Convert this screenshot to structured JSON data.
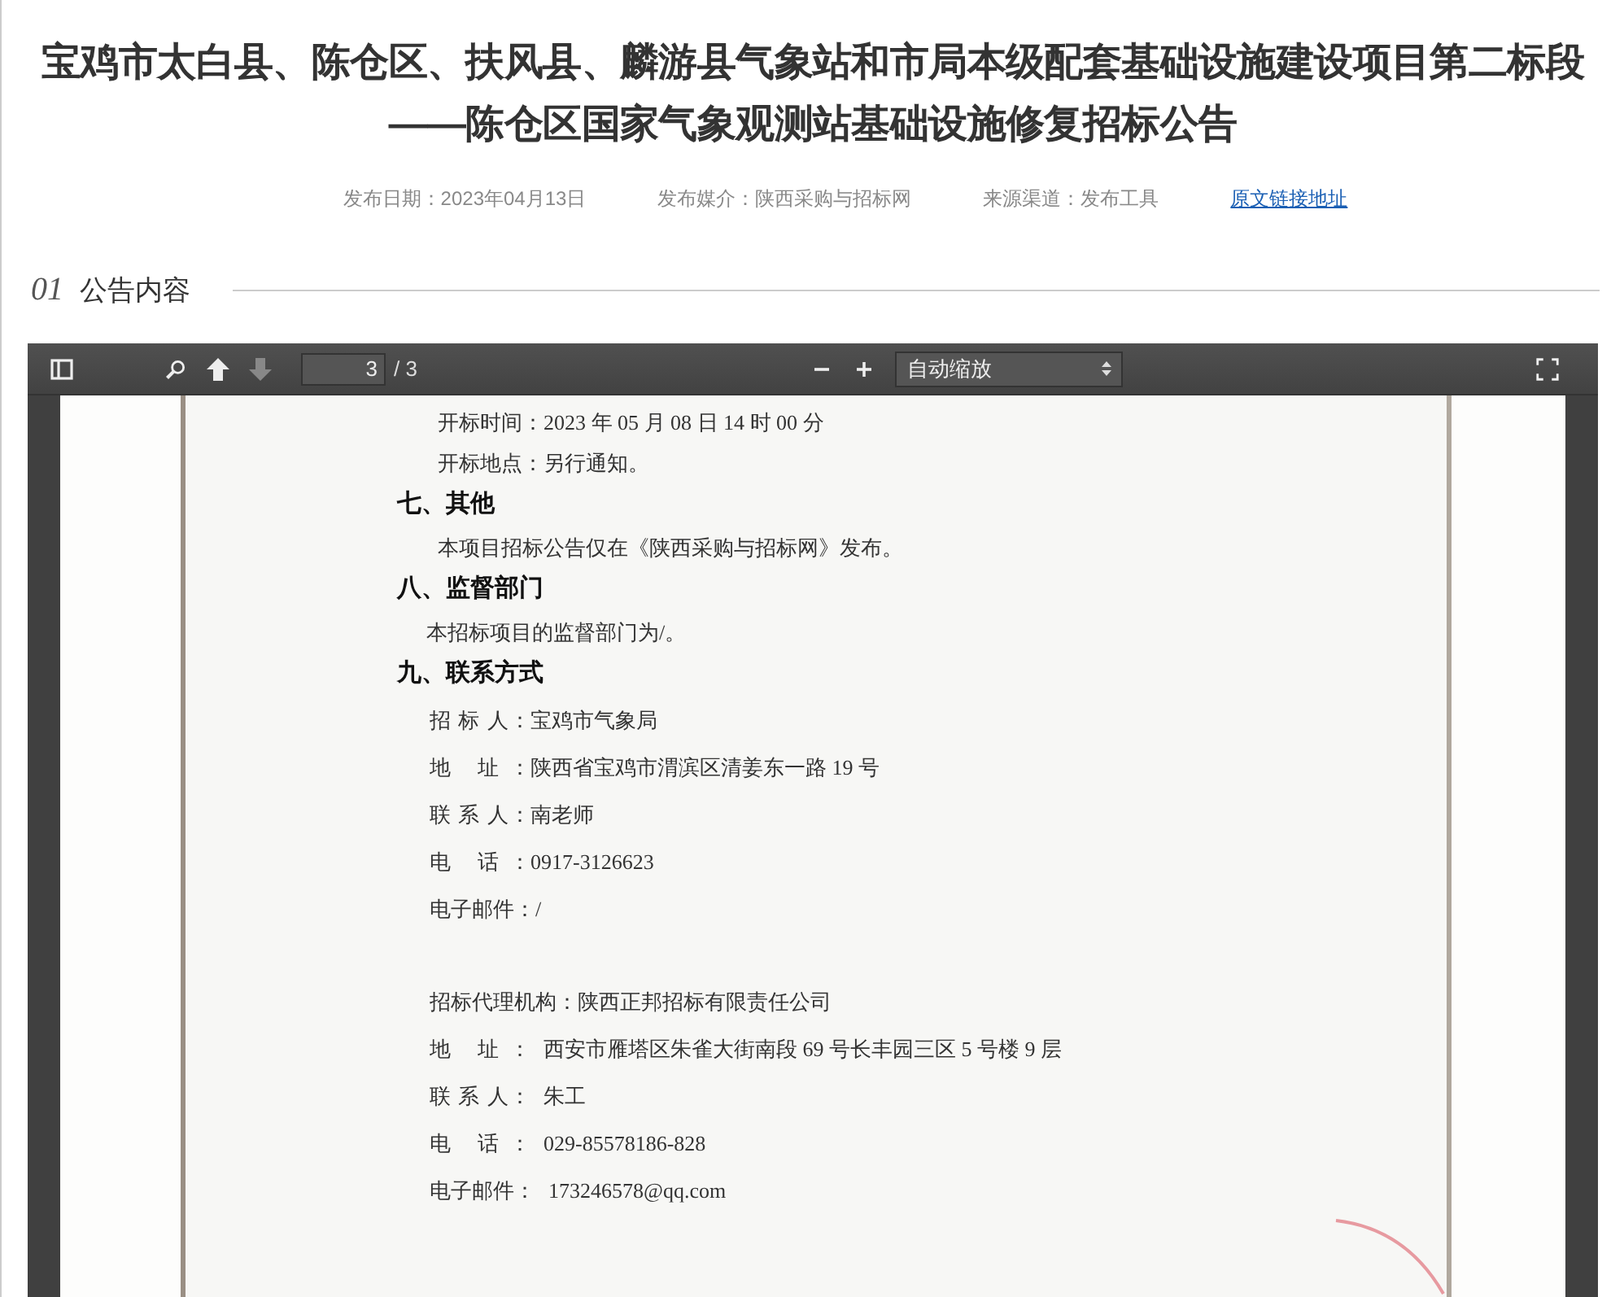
{
  "title": "宝鸡市太白县、陈仓区、扶风县、麟游县气象站和市局本级配套基础设施建设项目第二标段——陈仓区国家气象观测站基础设施修复招标公告",
  "meta": [
    {
      "kind": "text",
      "text": "发布日期：2023年04月13日"
    },
    {
      "kind": "text",
      "text": "发布媒介：陕西采购与招标网"
    },
    {
      "kind": "text",
      "text": "来源渠道：发布工具"
    },
    {
      "kind": "link",
      "text": "原文链接地址"
    }
  ],
  "section": {
    "number": "01",
    "label": "公告内容"
  },
  "viewer": {
    "toolbar": {
      "prev_disabled": false,
      "next_disabled": true,
      "page_input": "3",
      "page_count": "/ 3",
      "zoom_select": "自动缩放"
    },
    "lines": [
      {
        "kind": "body",
        "text": "开标时间：2023 年 05 月 08 日 14 时 00 分"
      },
      {
        "kind": "body",
        "text": "开标地点：另行通知。"
      },
      {
        "kind": "heading",
        "text": "七、其他"
      },
      {
        "kind": "body",
        "text": "本项目招标公告仅在《陕西采购与招标网》发布。"
      },
      {
        "kind": "heading",
        "text": "八、监督部门"
      },
      {
        "kind": "note",
        "text": "本招标项目的监督部门为/。"
      },
      {
        "kind": "heading",
        "text": "九、联系方式"
      },
      {
        "kind": "field",
        "label": "招 标 人：",
        "value": "宝鸡市气象局"
      },
      {
        "kind": "field",
        "label": "地 址：",
        "value": "陕西省宝鸡市渭滨区清姜东一路 19 号"
      },
      {
        "kind": "field",
        "label": "联 系 人：",
        "value": "南老师"
      },
      {
        "kind": "field",
        "label": "电 话：",
        "value": "0917-3126623"
      },
      {
        "kind": "field",
        "label": "电子邮件：",
        "value": "/"
      },
      {
        "kind": "gap"
      },
      {
        "kind": "agency",
        "label": "招标代理机构：",
        "value": "陕西正邦招标有限责任公司"
      },
      {
        "kind": "field2",
        "label": "地 址：",
        "value": "西安市雁塔区朱雀大街南段 69 号长丰园三区 5 号楼 9 层"
      },
      {
        "kind": "field2",
        "label": "联 系 人：",
        "value": "朱工"
      },
      {
        "kind": "field2",
        "label": "电 话：",
        "value": "029-85578186-828"
      },
      {
        "kind": "field2",
        "label": "电子邮件：",
        "value": "173246578@qq.com"
      }
    ]
  }
}
